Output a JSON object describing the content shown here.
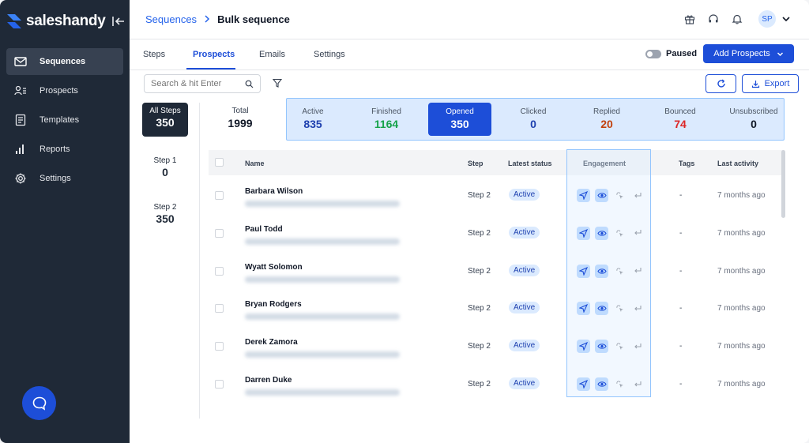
{
  "app": {
    "brand": "saleshandy",
    "colors": {
      "sidebar": "#1f2937",
      "accent": "#1d4ed8",
      "finished": "#16a34a",
      "replied": "#c2410c",
      "bounced": "#dc2626"
    }
  },
  "sidebar": {
    "items": [
      {
        "label": "Sequences",
        "icon": "mail-icon",
        "active": true
      },
      {
        "label": "Prospects",
        "icon": "prospects-icon",
        "active": false
      },
      {
        "label": "Templates",
        "icon": "templates-icon",
        "active": false
      },
      {
        "label": "Reports",
        "icon": "reports-icon",
        "active": false
      },
      {
        "label": "Settings",
        "icon": "gear-icon",
        "active": false
      }
    ]
  },
  "header": {
    "breadcrumb": {
      "parent": "Sequences",
      "current": "Bulk sequence"
    },
    "avatar_initials": "SP"
  },
  "tabs": {
    "items": [
      "Steps",
      "Prospects",
      "Emails",
      "Settings"
    ],
    "active": "Prospects",
    "paused_label": "Paused",
    "add_prospects_label": "Add Prospects"
  },
  "toolbar": {
    "search_placeholder": "Search & hit Enter",
    "export_label": "Export"
  },
  "steps_filter": [
    {
      "label": "All Steps",
      "count": "350",
      "active": true
    },
    {
      "label": "Step 1",
      "count": "0",
      "active": false
    },
    {
      "label": "Step 2",
      "count": "350",
      "active": false
    }
  ],
  "stats": {
    "total": {
      "label": "Total",
      "value": "1999"
    },
    "items": [
      {
        "label": "Active",
        "value": "835",
        "color": "#1e40af"
      },
      {
        "label": "Finished",
        "value": "1164",
        "color": "#16a34a"
      },
      {
        "label": "Opened",
        "value": "350",
        "color": "#ffffff",
        "selected": true
      },
      {
        "label": "Clicked",
        "value": "0",
        "color": "#1e40af"
      },
      {
        "label": "Replied",
        "value": "20",
        "color": "#c2410c"
      },
      {
        "label": "Bounced",
        "value": "74",
        "color": "#dc2626"
      },
      {
        "label": "Unsubscribed",
        "value": "0",
        "color": "#111827"
      }
    ]
  },
  "table": {
    "columns": {
      "name": "Name",
      "step": "Step",
      "status": "Latest status",
      "engagement": "Engagement",
      "tags": "Tags",
      "last_activity": "Last activity"
    },
    "rows": [
      {
        "name": "Barbara Wilson",
        "step": "Step 2",
        "status": "Active",
        "tags": "-",
        "last_activity": "7 months ago"
      },
      {
        "name": "Paul Todd",
        "step": "Step 2",
        "status": "Active",
        "tags": "-",
        "last_activity": "7 months ago"
      },
      {
        "name": "Wyatt Solomon",
        "step": "Step 2",
        "status": "Active",
        "tags": "-",
        "last_activity": "7 months ago"
      },
      {
        "name": "Bryan Rodgers",
        "step": "Step 2",
        "status": "Active",
        "tags": "-",
        "last_activity": "7 months ago"
      },
      {
        "name": "Derek Zamora",
        "step": "Step 2",
        "status": "Active",
        "tags": "-",
        "last_activity": "7 months ago"
      },
      {
        "name": "Darren Duke",
        "step": "Step 2",
        "status": "Active",
        "tags": "-",
        "last_activity": "7 months ago"
      }
    ]
  }
}
